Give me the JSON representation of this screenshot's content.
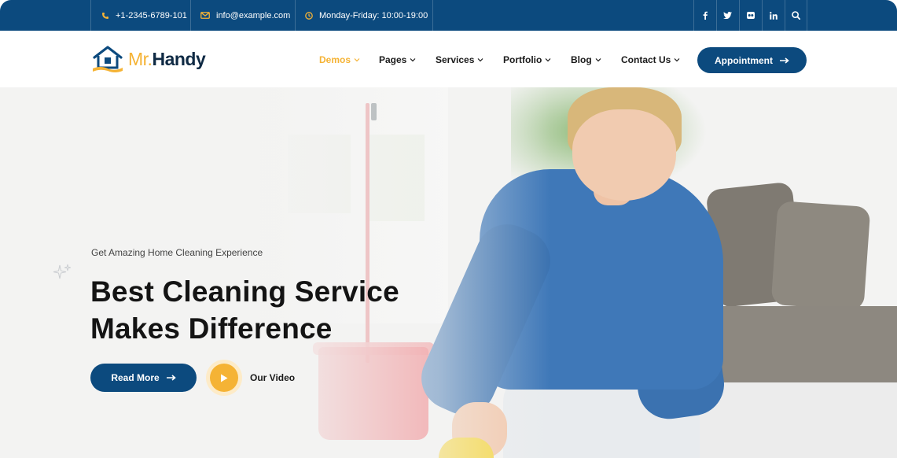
{
  "topbar": {
    "phone": "+1-2345-6789-101",
    "email": "info@example.com",
    "hours": "Monday-Friday: 10:00-19:00",
    "social": [
      {
        "icon": "facebook-icon",
        "glyph": "f"
      },
      {
        "icon": "twitter-icon",
        "glyph": "t"
      },
      {
        "icon": "flickr-icon",
        "glyph": "••"
      },
      {
        "icon": "linkedin-icon",
        "glyph": "in"
      },
      {
        "icon": "search-icon",
        "glyph": ""
      }
    ]
  },
  "header": {
    "logo": {
      "mr": "Mr.",
      "name": "Handy"
    },
    "nav": [
      {
        "label": "Demos",
        "active": true
      },
      {
        "label": "Pages",
        "active": false
      },
      {
        "label": "Services",
        "active": false
      },
      {
        "label": "Portfolio",
        "active": false
      },
      {
        "label": "Blog",
        "active": false
      },
      {
        "label": "Contact Us",
        "active": false
      }
    ],
    "cta_label": "Appointment"
  },
  "hero": {
    "subtitle": "Get Amazing Home Cleaning Experience",
    "title_line1": "Best Cleaning Service",
    "title_line2": "Makes Difference",
    "read_more_label": "Read More",
    "video_label": "Our Video"
  },
  "colors": {
    "primary": "#0c4a7e",
    "accent": "#f5b335",
    "text_dark": "#141414"
  }
}
